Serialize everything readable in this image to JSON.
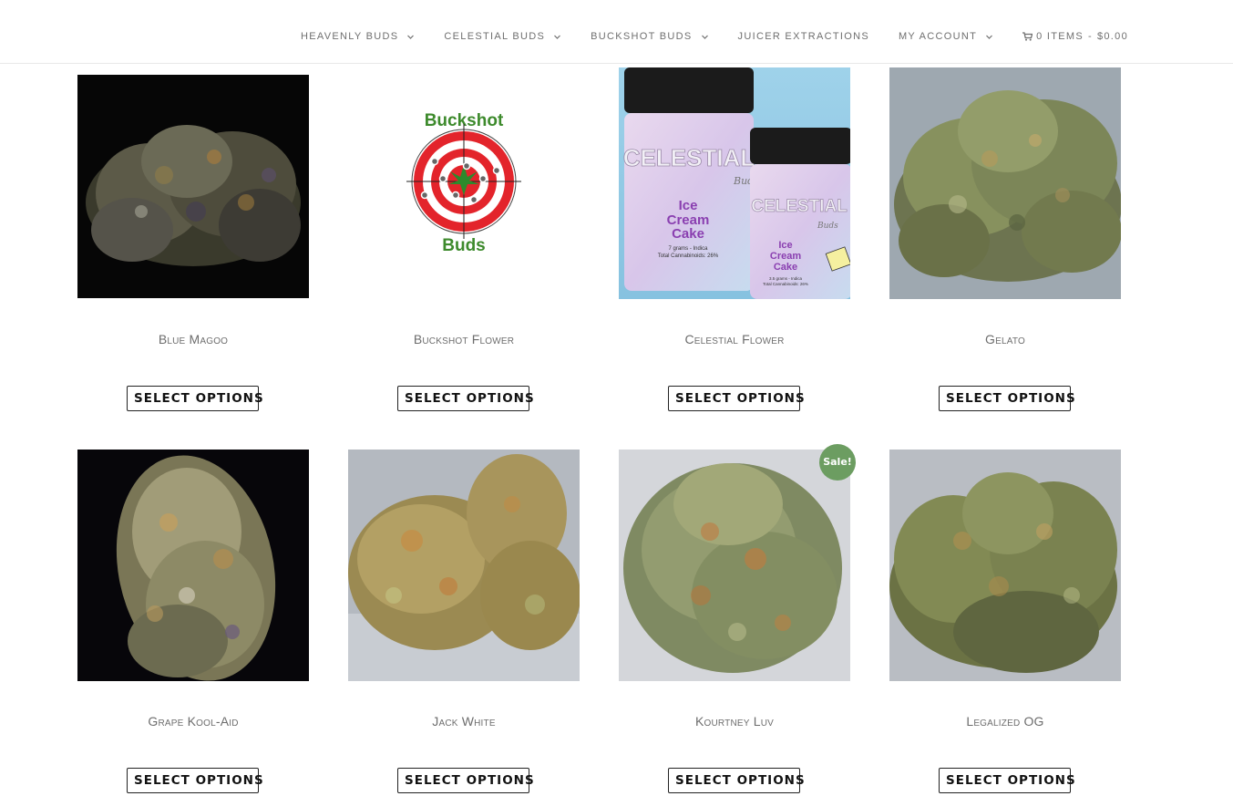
{
  "nav": {
    "items": [
      {
        "label": "HEAVENLY BUDS",
        "has_dropdown": true
      },
      {
        "label": "CELESTIAL BUDS",
        "has_dropdown": true
      },
      {
        "label": "BUCKSHOT BUDS",
        "has_dropdown": true
      },
      {
        "label": "JUICER EXTRACTIONS",
        "has_dropdown": false
      },
      {
        "label": "MY ACCOUNT",
        "has_dropdown": true
      }
    ],
    "cart": {
      "icon": "cart-icon",
      "items_label": "0 ITEMS",
      "separator": "-",
      "total": "$0.00"
    }
  },
  "products": [
    {
      "name": "Blue Magoo",
      "button": "SELECT OPTIONS",
      "image": "dark-bud-photo",
      "sale": false
    },
    {
      "name": "Buckshot Flower",
      "button": "SELECT OPTIONS",
      "image": "buckshot-logo",
      "sale": false
    },
    {
      "name": "Celestial Flower",
      "button": "SELECT OPTIONS",
      "image": "celestial-jars-photo",
      "sale": false
    },
    {
      "name": "Gelato",
      "button": "SELECT OPTIONS",
      "image": "grey-bud-photo",
      "sale": false
    },
    {
      "name": "Grape Kool-Aid",
      "button": "SELECT OPTIONS",
      "image": "dark-bud-photo",
      "sale": false
    },
    {
      "name": "Jack White",
      "button": "SELECT OPTIONS",
      "image": "grey-bud-photo",
      "sale": false
    },
    {
      "name": "Kourtney Luv",
      "button": "SELECT OPTIONS",
      "image": "grey-bud-photo",
      "sale": true
    },
    {
      "name": "Legalized OG",
      "button": "SELECT OPTIONS",
      "image": "grey-bud-photo",
      "sale": false
    }
  ],
  "buckshot_logo": {
    "top_text": "Buckshot",
    "bottom_text": "Buds"
  },
  "celestial_jar": {
    "brand": "CELESTIAL",
    "script": "Buds",
    "strain": [
      "Ice",
      "Cream",
      "Cake"
    ],
    "detail_large": [
      "7 grams - Indica",
      "Total Cannabinoids: 26%"
    ],
    "detail_small": [
      "3.5 grams - Indica",
      "Total Cannabinoids: 26%"
    ]
  },
  "sale_badge": "Sale!",
  "colors": {
    "sale_badge": "#6c9d61",
    "nav_text": "#6f6f6f",
    "button_border": "#222222"
  }
}
